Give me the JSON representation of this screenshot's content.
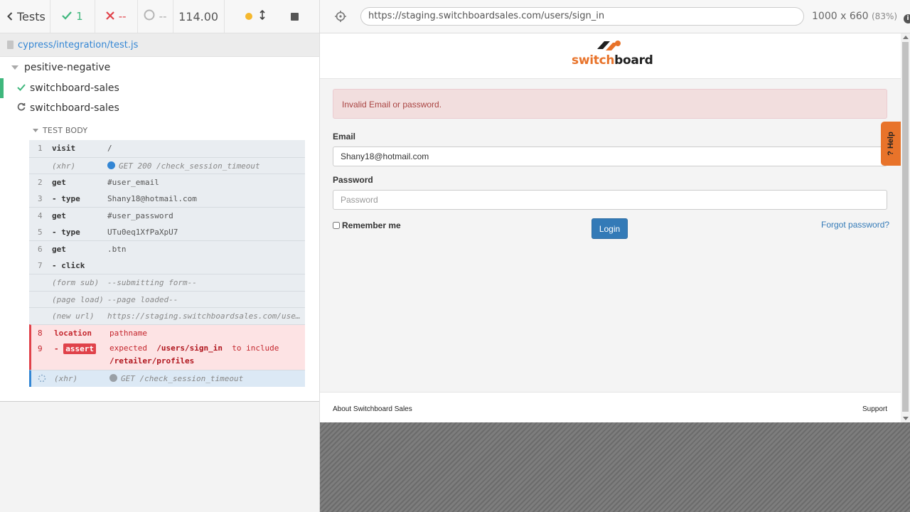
{
  "reporter": {
    "tests_label": "Tests",
    "passed_count": "1",
    "failed_count": "--",
    "pending_count": "--",
    "duration": "114.00",
    "spec_file": "cypress/integration/test.js",
    "suite_title": "pesitive-negative",
    "tests": [
      {
        "title": "switchboard-sales",
        "state": "passed"
      },
      {
        "title": "switchboard-sales",
        "state": "running"
      }
    ],
    "test_body_label": "TEST BODY",
    "commands": [
      {
        "num": "1",
        "name": "visit",
        "message": "/"
      },
      {
        "num": "",
        "name": "(xhr)",
        "message": "GET 200 /check_session_timeout"
      },
      {
        "num": "2",
        "name": "get",
        "message": "#user_email"
      },
      {
        "num": "3",
        "name": "- type",
        "message": "Shany18@hotmail.com"
      },
      {
        "num": "4",
        "name": "get",
        "message": "#user_password"
      },
      {
        "num": "5",
        "name": "- type",
        "message": "UTu0eq1XfPaXpU7"
      },
      {
        "num": "6",
        "name": "get",
        "message": ".btn"
      },
      {
        "num": "7",
        "name": "- click",
        "message": ""
      },
      {
        "num": "",
        "name": "(form sub)",
        "message": "--submitting form--"
      },
      {
        "num": "",
        "name": "(page load)",
        "message": "--page loaded--"
      },
      {
        "num": "",
        "name": "(new url)",
        "message": "https://staging.switchboardsales.com/users/sign_in"
      },
      {
        "num": "8",
        "name": "location",
        "message": "pathname"
      },
      {
        "num": "9",
        "name": "assert",
        "message_prefix": "expected",
        "message_actual": "/users/sign_in",
        "message_mid": "to include",
        "message_expected": "/retailer/profiles"
      },
      {
        "num": "",
        "name": "(xhr)",
        "message": "GET /check_session_timeout"
      }
    ]
  },
  "browser": {
    "url": "https://staging.switchboardsales.com/users/sign_in",
    "viewport": "1000 x 660",
    "scale": "(83%)"
  },
  "site": {
    "logo_part1": "switch",
    "logo_part2": "board",
    "alert": "Invalid Email or password.",
    "email_label": "Email",
    "email_value": "Shany18@hotmail.com",
    "password_label": "Password",
    "password_placeholder": "Password",
    "remember_label": "Remember me",
    "login_button": "Login",
    "forgot_link": "Forgot password?",
    "help_tab": "? Help",
    "footer_left": "About Switchboard Sales",
    "footer_right": "Support",
    "brand_orange": "#e8732a"
  }
}
